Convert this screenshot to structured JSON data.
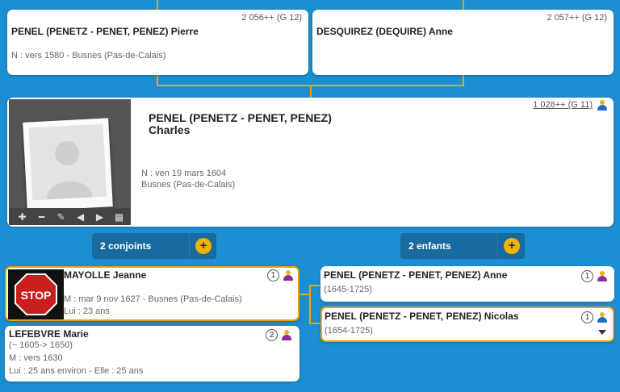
{
  "colors": {
    "background": "#1b8fd2",
    "accent": "#f0a500",
    "male": "#1e6fc4",
    "female": "#8b2c9a"
  },
  "father": {
    "name": "PENEL (PENETZ - PENET, PENEZ) Pierre",
    "ref": "2 056++ (G 12)",
    "birth": "N : vers 1580 - Busnes (Pas-de-Calais)"
  },
  "mother": {
    "name": "DESQUIREZ (DEQUIRE) Anne",
    "ref": "2 057++ (G 12)"
  },
  "focus": {
    "name_line1": "PENEL (PENETZ - PENET, PENEZ)",
    "name_line2": "Charles",
    "ref": "1 028++ (G 11)",
    "birth": "N : ven 19 mars 1604",
    "place": "Busnes (Pas-de-Calais)",
    "toolbar": [
      {
        "icon": "plus-icon",
        "glyph": "✚"
      },
      {
        "icon": "minus-icon",
        "glyph": "━"
      },
      {
        "icon": "pencil-icon",
        "glyph": "✎"
      },
      {
        "icon": "prev-icon",
        "glyph": "◀"
      },
      {
        "icon": "next-icon",
        "glyph": "▶"
      },
      {
        "icon": "film-icon",
        "glyph": "▦"
      }
    ]
  },
  "spouses_toggle": {
    "label": "2 conjoints",
    "plus": "+"
  },
  "children_toggle": {
    "label": "2 enfants",
    "plus": "+"
  },
  "spouses": [
    {
      "name": "MAYOLLE Jeanne",
      "num": "1",
      "marriage": "M : mar 9 nov 1627 - Busnes (Pas-de-Calais)",
      "age": "Lui : 23 ans",
      "photo_text": "STOP"
    },
    {
      "name": "LEFEBVRE Marie",
      "num": "2",
      "dates": "(~ 1605-> 1650)",
      "marriage": "M : vers 1630",
      "age": "Lui : 25 ans environ - Elle : 25 ans"
    }
  ],
  "children": [
    {
      "name": "PENEL (PENETZ - PENET, PENEZ) Anne",
      "num": "1",
      "dates": "(1645-1725)"
    },
    {
      "name": "PENEL (PENETZ - PENET, PENEZ) Nicolas",
      "num": "1",
      "dates": "(1654-1725)"
    }
  ]
}
